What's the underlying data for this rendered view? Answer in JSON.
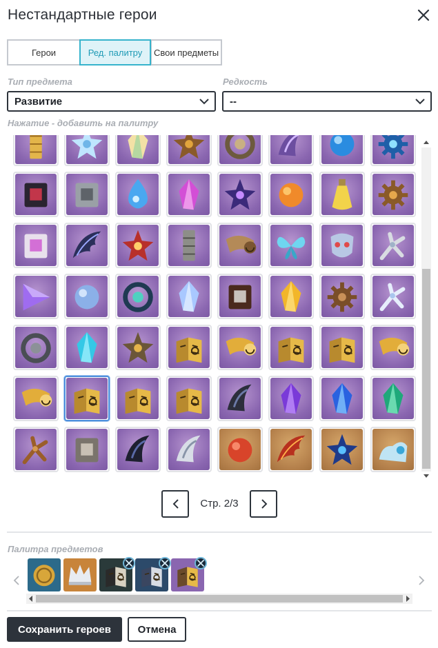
{
  "dialog": {
    "title": "Нестандартные герои"
  },
  "tabs": [
    {
      "label": "Герои",
      "active": false
    },
    {
      "label": "Ред. палитру",
      "active": true
    },
    {
      "label": "Свои предметы",
      "active": false
    }
  ],
  "filters": {
    "type_label": "Тип предмета",
    "type_value": "Развитие",
    "rarity_label": "Редкость",
    "rarity_value": "--"
  },
  "hint": "Нажатие - добавить на палитру",
  "colors": {
    "accent": "#36b3cc",
    "dark": "#2d333b",
    "card_purple": "#8a66b0",
    "card_gold": "#b5814c"
  },
  "grid_items": [
    {
      "icon": "gold-pillar-icon",
      "bg": "purple"
    },
    {
      "icon": "ice-crystal-flower-icon",
      "bg": "purple"
    },
    {
      "icon": "prism-gem-icon",
      "bg": "purple"
    },
    {
      "icon": "spiked-core-icon",
      "bg": "purple"
    },
    {
      "icon": "stone-ring-icon",
      "bg": "purple"
    },
    {
      "icon": "violet-claw-icon",
      "bg": "purple"
    },
    {
      "icon": "blue-orb-icon",
      "bg": "purple"
    },
    {
      "icon": "electro-sigil-icon",
      "bg": "purple"
    },
    {
      "icon": "dark-mask-icon",
      "bg": "purple"
    },
    {
      "icon": "stone-tablet-icon",
      "bg": "purple"
    },
    {
      "icon": "hydro-drop-icon",
      "bg": "purple"
    },
    {
      "icon": "magenta-crystal-icon",
      "bg": "purple"
    },
    {
      "icon": "purple-spiked-orb-icon",
      "bg": "purple"
    },
    {
      "icon": "fire-swirl-icon",
      "bg": "purple"
    },
    {
      "icon": "potion-bottle-icon",
      "bg": "purple"
    },
    {
      "icon": "bronze-gear-core-icon",
      "bg": "purple"
    },
    {
      "icon": "cube-device-icon",
      "bg": "purple"
    },
    {
      "icon": "dark-wing-icon",
      "bg": "purple"
    },
    {
      "icon": "red-flower-icon",
      "bg": "purple"
    },
    {
      "icon": "stone-pillar-icon",
      "bg": "purple"
    },
    {
      "icon": "horn-icon",
      "bg": "purple"
    },
    {
      "icon": "blue-butterfly-icon",
      "bg": "purple"
    },
    {
      "icon": "oni-mask-icon",
      "bg": "purple"
    },
    {
      "icon": "silver-branch-icon",
      "bg": "purple"
    },
    {
      "icon": "violet-prism-icon",
      "bg": "purple"
    },
    {
      "icon": "blue-shell-icon",
      "bg": "purple"
    },
    {
      "icon": "teal-orb-device-icon",
      "bg": "purple"
    },
    {
      "icon": "blue-crystal-shard-icon",
      "bg": "purple"
    },
    {
      "icon": "pearl-box-icon",
      "bg": "purple"
    },
    {
      "icon": "amber-crystal-icon",
      "bg": "purple"
    },
    {
      "icon": "bronze-gear-icon",
      "bg": "purple"
    },
    {
      "icon": "coral-branch-icon",
      "bg": "purple"
    },
    {
      "icon": "chain-ring-icon",
      "bg": "purple"
    },
    {
      "icon": "cyan-crystal-icon",
      "bg": "purple"
    },
    {
      "icon": "bronze-star-icon",
      "bg": "purple"
    },
    {
      "icon": "golden-book-icon",
      "bg": "purple"
    },
    {
      "icon": "golden-horn-icon",
      "bg": "purple"
    },
    {
      "icon": "golden-book-icon",
      "bg": "purple"
    },
    {
      "icon": "golden-book-icon",
      "bg": "purple"
    },
    {
      "icon": "golden-horn-icon",
      "bg": "purple"
    },
    {
      "icon": "golden-horn-icon",
      "bg": "purple"
    },
    {
      "icon": "golden-book-icon",
      "bg": "purple",
      "selected": true
    },
    {
      "icon": "golden-book-icon",
      "bg": "purple"
    },
    {
      "icon": "golden-book-icon",
      "bg": "purple"
    },
    {
      "icon": "dark-blade-icon",
      "bg": "purple"
    },
    {
      "icon": "purple-crystal-icon",
      "bg": "purple"
    },
    {
      "icon": "blue-gem-icon",
      "bg": "purple"
    },
    {
      "icon": "green-gem-icon",
      "bg": "purple"
    },
    {
      "icon": "bronze-staff-icon",
      "bg": "purple"
    },
    {
      "icon": "silver-rock-icon",
      "bg": "purple"
    },
    {
      "icon": "dark-claw-icon",
      "bg": "purple"
    },
    {
      "icon": "silver-fang-icon",
      "bg": "purple"
    },
    {
      "icon": "red-orb-icon",
      "bg": "gold"
    },
    {
      "icon": "flame-claw-icon",
      "bg": "gold"
    },
    {
      "icon": "blue-star-shard-icon",
      "bg": "gold"
    },
    {
      "icon": "crystal-slipper-icon",
      "bg": "gold"
    }
  ],
  "pagination": {
    "text": "Стр. 2/3",
    "current": 2,
    "total": 3
  },
  "palette": {
    "label": "Палитра предметов",
    "items": [
      {
        "icon": "gold-coin-icon",
        "removable": false
      },
      {
        "icon": "silver-crown-icon",
        "removable": false
      },
      {
        "icon": "teal-book-icon",
        "removable": true
      },
      {
        "icon": "blue-book-icon",
        "removable": true
      },
      {
        "icon": "purple-book-icon",
        "removable": true
      }
    ]
  },
  "footer": {
    "save_label": "Сохранить героев",
    "cancel_label": "Отмена"
  }
}
